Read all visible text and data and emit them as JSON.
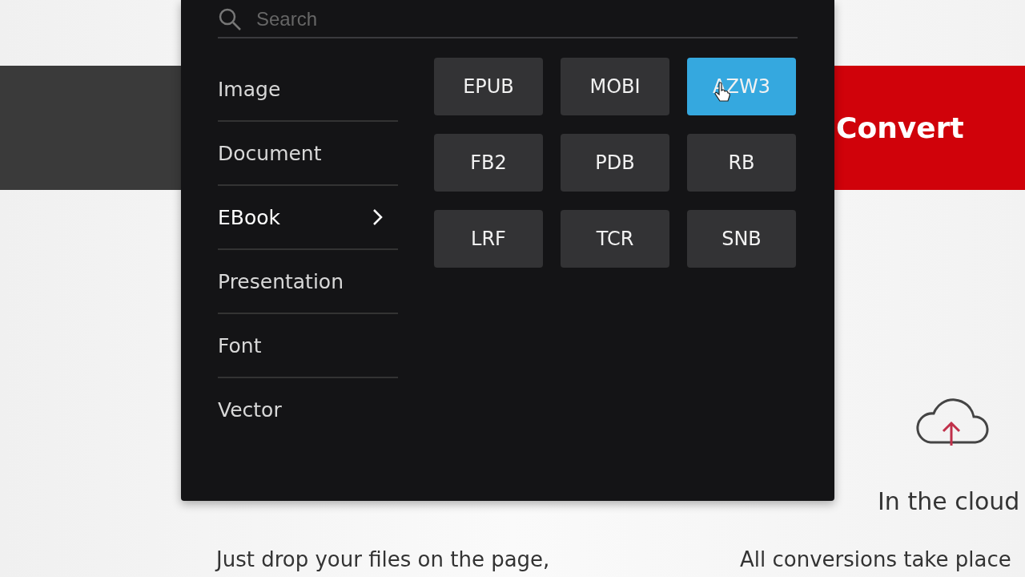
{
  "search": {
    "placeholder": "Search"
  },
  "categories": [
    {
      "label": "Image",
      "selected": false
    },
    {
      "label": "Document",
      "selected": false
    },
    {
      "label": "EBook",
      "selected": true
    },
    {
      "label": "Presentation",
      "selected": false
    },
    {
      "label": "Font",
      "selected": false
    },
    {
      "label": "Vector",
      "selected": false
    }
  ],
  "formats": [
    {
      "label": "EPUB",
      "selected": false
    },
    {
      "label": "MOBI",
      "selected": false
    },
    {
      "label": "AZW3",
      "selected": true
    },
    {
      "label": "FB2",
      "selected": false
    },
    {
      "label": "PDB",
      "selected": false
    },
    {
      "label": "RB",
      "selected": false
    },
    {
      "label": "LRF",
      "selected": false
    },
    {
      "label": "TCR",
      "selected": false
    },
    {
      "label": "SNB",
      "selected": false
    }
  ],
  "convert_button": "Convert",
  "features": [
    {
      "kind": "plain",
      "text": "Just drop your files on the page,"
    },
    {
      "kind": "cloud",
      "title": "In the cloud",
      "text": "All conversions take place"
    }
  ]
}
